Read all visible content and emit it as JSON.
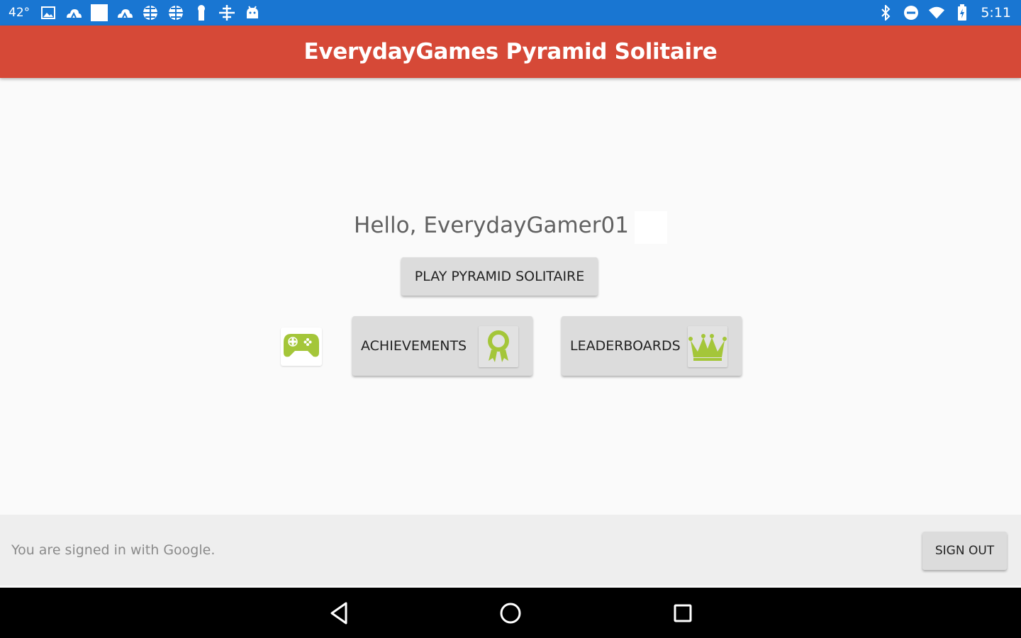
{
  "status_bar": {
    "temperature": "42°",
    "time": "5:11",
    "icons_left": [
      "image-icon",
      "cloud-icon",
      "square-icon",
      "cloud-icon",
      "globe-icon",
      "globe-icon",
      "keyhole-icon",
      "crosshair-icon",
      "android-icon"
    ],
    "icons_right": [
      "bluetooth-icon",
      "do-not-disturb-icon",
      "wifi-icon",
      "battery-icon"
    ],
    "background_color": "#1976d2"
  },
  "app_bar": {
    "title": "EverydayGames Pyramid Solitaire",
    "background_color": "#d64937"
  },
  "main": {
    "greeting": "Hello, EverydayGamer01",
    "play_button_label": "PLAY PYRAMID SOLITAIRE",
    "games_icon": "play-games-controller-icon",
    "achievements_button_label": "ACHIEVEMENTS",
    "achievements_icon": "ribbon-award-icon",
    "leaderboards_button_label": "LEADERBOARDS",
    "leaderboards_icon": "crown-icon",
    "icon_accent_color": "#a4c639"
  },
  "footer": {
    "signed_in_text": "You are signed in with Google.",
    "sign_out_label": "SIGN OUT"
  },
  "nav_bar": {
    "buttons": [
      "back-icon",
      "home-icon",
      "recents-icon"
    ]
  }
}
